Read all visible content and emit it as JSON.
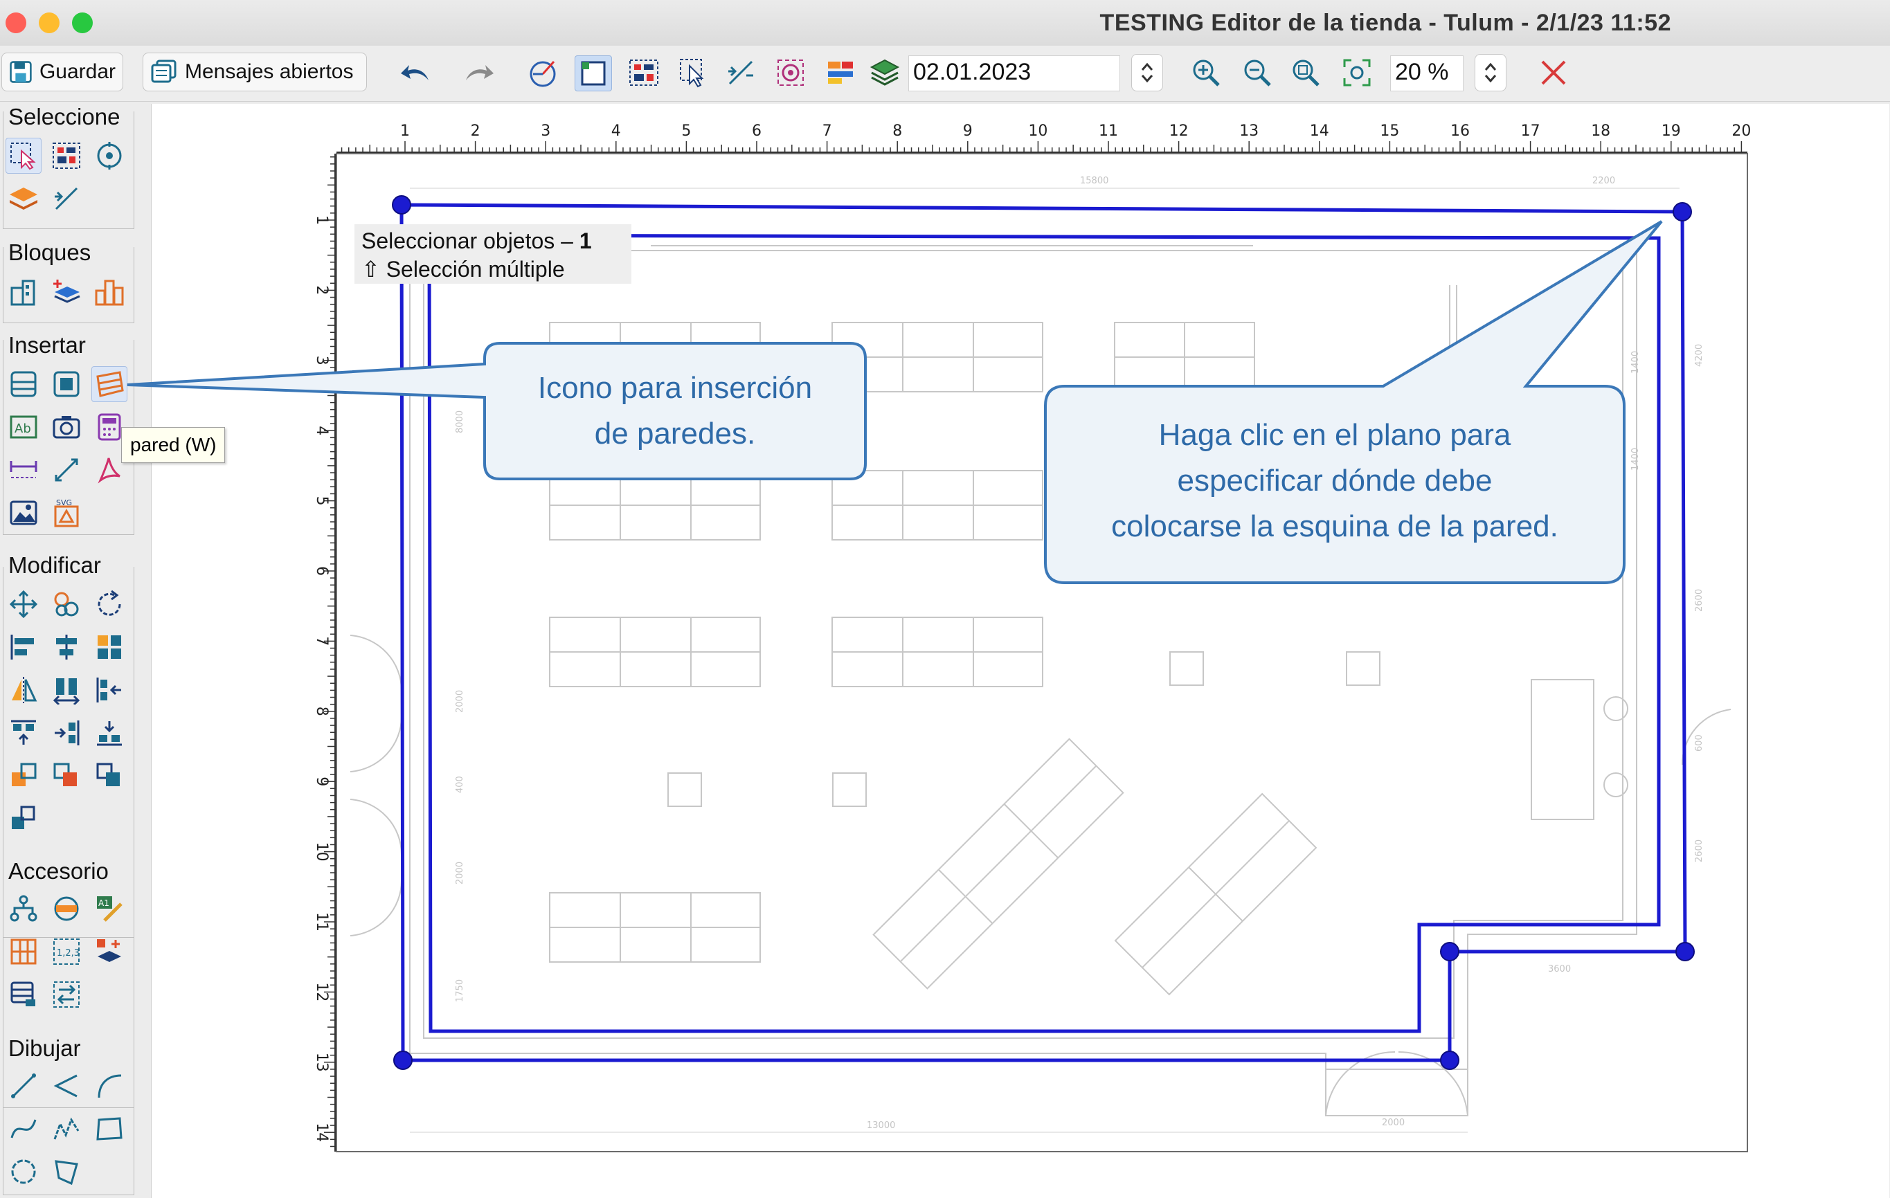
{
  "window": {
    "title": "TESTING Editor de la tienda - Tulum - 2/1/23 11:52"
  },
  "toolbar": {
    "save_label": "Guardar",
    "messages_label": "Mensajes abiertos",
    "date_value": "02.01.2023",
    "zoom_value": "20 %"
  },
  "palette": {
    "sections": [
      "Seleccione",
      "Bloques",
      "Insertar",
      "Modificar",
      "Accesorio",
      "Dibujar"
    ]
  },
  "tooltip": {
    "text": "pared  (W)"
  },
  "selection_info": {
    "line1": "Seleccionar objetos –",
    "count": "1",
    "line2": "Selección múltiple"
  },
  "ruler": {
    "top": [
      "1",
      "2",
      "3",
      "4",
      "5",
      "6",
      "7",
      "8",
      "9",
      "10",
      "11",
      "12",
      "13",
      "14",
      "15",
      "16",
      "17",
      "18",
      "19",
      "20"
    ],
    "left": [
      "1",
      "2",
      "3",
      "4",
      "5",
      "6",
      "7",
      "8",
      "9",
      "10",
      "11",
      "12",
      "13",
      "14"
    ]
  },
  "dimensions": {
    "top_total": "15800",
    "top_right": "2200",
    "bottom_total": "13000",
    "bottom_door": "2000",
    "right_a": "1400",
    "right_b": "1400",
    "right_c": "4200",
    "right_d": "2600",
    "right_e": "600",
    "right_f": "2600",
    "step": "3600",
    "left_a": "8000",
    "left_b": "2000",
    "left_c": "400",
    "left_d": "2000",
    "left_e": "1750"
  },
  "callouts": {
    "icon_line1": "Icono para inserción",
    "icon_line2": "de paredes.",
    "plan_line1": "Haga clic en el plano para",
    "plan_line2": "especificar dónde debe",
    "plan_line3": "colocarse la esquina de la pared."
  },
  "colors": {
    "wall": "#1b1bd0",
    "callout_border": "#3b78b8",
    "callout_fill": "#edf3f9",
    "callout_text": "#2e6aa8"
  }
}
